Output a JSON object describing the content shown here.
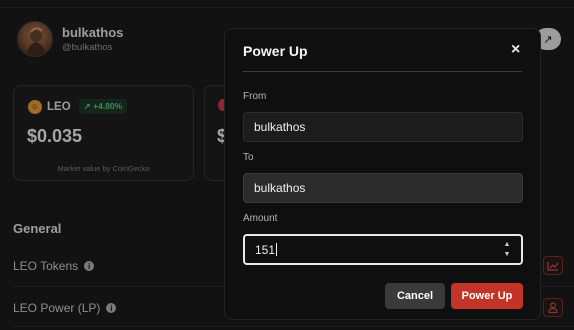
{
  "profile": {
    "name": "bulkathos",
    "handle": "@bulkathos"
  },
  "leo_card": {
    "symbol": "LEO",
    "change": "↗ +4.80%",
    "price": "$0.035",
    "footnote": "Market value by CoinGecko"
  },
  "second_card": {
    "price_partial": "$"
  },
  "general": {
    "heading": "General",
    "rows": [
      {
        "label": "LEO Tokens"
      },
      {
        "label": "LEO Power (LP)"
      }
    ]
  },
  "modal": {
    "title": "Power Up",
    "close_glyph": "×",
    "from_label": "From",
    "from_value": "bulkathos",
    "to_label": "To",
    "to_value": "bulkathos",
    "amount_label": "Amount",
    "amount_value": "151",
    "cancel_label": "Cancel",
    "submit_label": "Power Up"
  },
  "colors": {
    "accent": "#c23427",
    "positive": "#5fd68a",
    "background": "#1c1c1d",
    "modal_bg": "#0f0f10"
  },
  "icons": [
    "external-link-icon",
    "info-icon",
    "chart-icon",
    "user-icon",
    "close-icon",
    "spinner-up-icon",
    "spinner-down-icon"
  ]
}
